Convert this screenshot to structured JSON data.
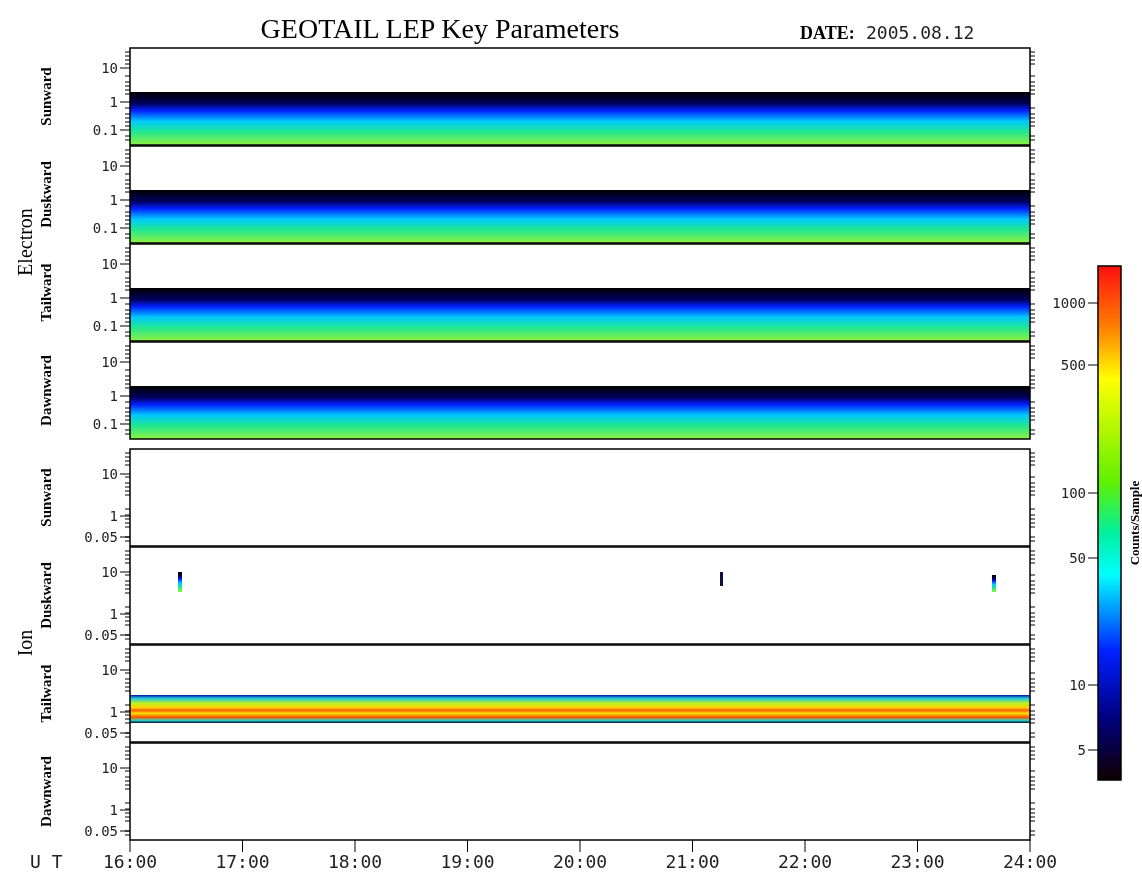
{
  "title": "GEOTAIL LEP Key Parameters",
  "date_label": "DATE:",
  "date": "2005.08.12",
  "groups": [
    {
      "name": "Electron",
      "panels": [
        {
          "direction": "Sunward",
          "kind": "electron_band",
          "yticks": [
            "10",
            "1",
            "0.1"
          ]
        },
        {
          "direction": "Duskward",
          "kind": "electron_band",
          "yticks": [
            "10",
            "1",
            "0.1"
          ]
        },
        {
          "direction": "Tailward",
          "kind": "electron_band",
          "yticks": [
            "10",
            "1",
            "0.1"
          ]
        },
        {
          "direction": "Dawnward",
          "kind": "electron_band",
          "yticks": [
            "10",
            "1",
            "0.1"
          ]
        }
      ]
    },
    {
      "name": "Ion",
      "panels": [
        {
          "direction": "Sunward",
          "kind": "empty",
          "yticks": [
            "10",
            "1",
            "0.05"
          ]
        },
        {
          "direction": "Duskward",
          "kind": "spikes",
          "yticks": [
            "10",
            "1",
            "0.05"
          ]
        },
        {
          "direction": "Tailward",
          "kind": "ion_band",
          "yticks": [
            "10",
            "1",
            "0.05"
          ]
        },
        {
          "direction": "Dawnward",
          "kind": "empty",
          "yticks": [
            "10",
            "1",
            "0.05"
          ]
        }
      ]
    }
  ],
  "xaxis": {
    "label": "U T",
    "ticks": [
      "16:00",
      "17:00",
      "18:00",
      "19:00",
      "20:00",
      "21:00",
      "22:00",
      "23:00",
      "24:00"
    ]
  },
  "colorbar": {
    "label": "Counts/Sample",
    "ticks": [
      "1000",
      "500",
      "100",
      "50",
      "10",
      "5"
    ]
  }
}
